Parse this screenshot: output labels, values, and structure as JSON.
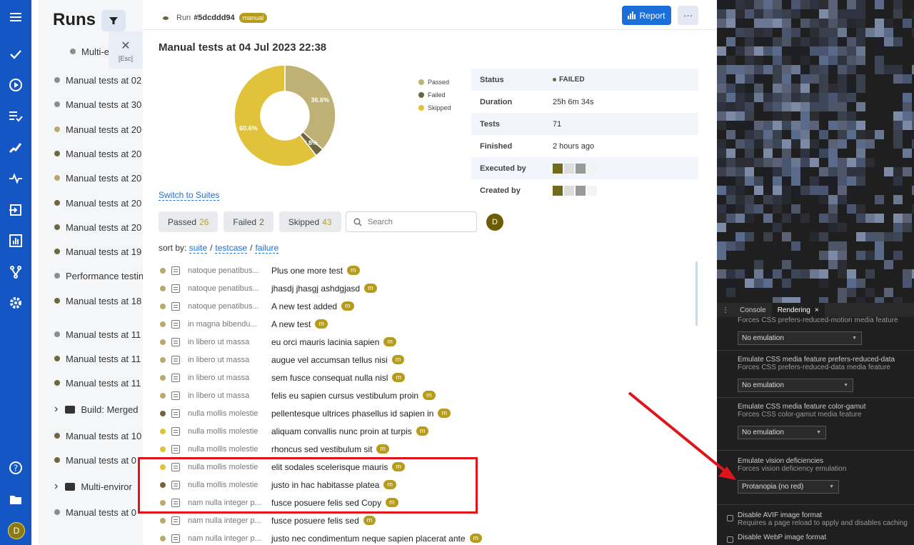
{
  "runs_panel": {
    "title": "Runs",
    "items": [
      {
        "label": "Multi-e",
        "status": "neutral",
        "type": "run"
      },
      {
        "label": "Manual tests at 02",
        "status": "neutral",
        "type": "run"
      },
      {
        "label": "Manual tests at 30",
        "status": "neutral",
        "type": "run"
      },
      {
        "label": "Manual tests at 20",
        "status": "passed",
        "type": "run"
      },
      {
        "label": "Manual tests at 20",
        "status": "failed",
        "type": "run"
      },
      {
        "label": "Manual tests at 20",
        "status": "passed",
        "type": "run"
      },
      {
        "label": "Manual tests at 20",
        "status": "failed",
        "type": "run"
      },
      {
        "label": "Manual tests at 20",
        "status": "failed",
        "type": "run"
      },
      {
        "label": "Manual tests at 19",
        "status": "failed",
        "type": "run"
      },
      {
        "label": "Performance testin",
        "status": "neutral",
        "type": "run"
      },
      {
        "label": "Manual tests at 18",
        "status": "failed",
        "type": "run"
      },
      {
        "label": "Manual tests at 11",
        "status": "neutral",
        "type": "run"
      },
      {
        "label": "Manual tests at 11",
        "status": "failed",
        "type": "run"
      },
      {
        "label": "Manual tests at 11",
        "status": "failed",
        "type": "run"
      },
      {
        "label": "Build: Merged",
        "status": "",
        "type": "folder"
      },
      {
        "label": "Manual tests at 10",
        "status": "failed",
        "type": "run"
      },
      {
        "label": "Manual tests at 0",
        "status": "failed",
        "type": "run"
      },
      {
        "label": "Multi-enviror",
        "status": "",
        "type": "folder"
      },
      {
        "label": "Manual tests at 0",
        "status": "neutral",
        "type": "run"
      }
    ],
    "esc_label": "[Esc]"
  },
  "rail": {
    "avatar_initial": "D",
    "icons": [
      "menu-icon",
      "check-icon",
      "play-icon",
      "list-check-icon",
      "steps-icon",
      "pulse-icon",
      "import-icon",
      "bar-chart-icon",
      "branch-icon",
      "gear-icon",
      "help-icon",
      "folder-icon"
    ]
  },
  "topbar": {
    "run_prefix": "Run",
    "run_id": "#5dcddd94",
    "run_badge": "manual",
    "report_label": "Report",
    "more_label": "···"
  },
  "run": {
    "title": "Manual tests at 04 Jul 2023 22:38",
    "switch_label": "Switch to Suites",
    "details": [
      {
        "key": "Status",
        "value": "FAILED"
      },
      {
        "key": "Duration",
        "value": "25h 6m 34s"
      },
      {
        "key": "Tests",
        "value": "71"
      },
      {
        "key": "Finished",
        "value": "2 hours ago"
      },
      {
        "key": "Executed by",
        "value": ""
      },
      {
        "key": "Created by",
        "value": ""
      }
    ]
  },
  "chart_data": {
    "type": "pie",
    "categories": [
      "Passed",
      "Failed",
      "Skipped"
    ],
    "values": [
      36.6,
      2.8,
      60.6
    ],
    "slice_labels": [
      "36.6%",
      "2.8%",
      "60.6%"
    ],
    "colors": [
      "#bfb074",
      "#6f6640",
      "#e0c33a"
    ],
    "legend": "right"
  },
  "filters": {
    "passed_label": "Passed",
    "passed_count": "26",
    "failed_label": "Failed",
    "failed_count": "2",
    "skipped_label": "Skipped",
    "skipped_count": "43",
    "search_placeholder": "Search",
    "user_initial": "D"
  },
  "sort": {
    "label": "sort by:",
    "options": [
      "suite",
      "testcase",
      "failure"
    ]
  },
  "tests": [
    {
      "status": "passed",
      "suite": "natoque penatibus...",
      "name": "Plus one more test",
      "tag": "m"
    },
    {
      "status": "passed",
      "suite": "natoque penatibus...",
      "name": "jhasdj jhasgj ashdgjasd",
      "tag": "m"
    },
    {
      "status": "passed",
      "suite": "natoque penatibus...",
      "name": "A new test added",
      "tag": "m"
    },
    {
      "status": "passed",
      "suite": "in magna bibendu...",
      "name": "A new test",
      "tag": "m"
    },
    {
      "status": "passed",
      "suite": "in libero ut massa",
      "name": "eu orci mauris lacinia sapien",
      "tag": "m"
    },
    {
      "status": "passed",
      "suite": "in libero ut massa",
      "name": "augue vel accumsan tellus nisi",
      "tag": "m"
    },
    {
      "status": "passed",
      "suite": "in libero ut massa",
      "name": "sem fusce consequat nulla nisl",
      "tag": "m"
    },
    {
      "status": "passed",
      "suite": "in libero ut massa",
      "name": "felis eu sapien cursus vestibulum proin",
      "tag": "m"
    },
    {
      "status": "failed",
      "suite": "nulla mollis molestie",
      "name": "pellentesque ultrices phasellus id sapien in",
      "tag": "m"
    },
    {
      "status": "skipped",
      "suite": "nulla mollis molestie",
      "name": "aliquam convallis nunc proin at turpis",
      "tag": "m"
    },
    {
      "status": "skipped",
      "suite": "nulla mollis molestie",
      "name": "rhoncus sed vestibulum sit",
      "tag": "m"
    },
    {
      "status": "skipped",
      "suite": "nulla mollis molestie",
      "name": "elit sodales scelerisque mauris",
      "tag": "m"
    },
    {
      "status": "failed",
      "suite": "nulla mollis molestie",
      "name": "justo in hac habitasse platea",
      "tag": "m"
    },
    {
      "status": "passed",
      "suite": "nam nulla integer p...",
      "name": "fusce posuere felis sed Copy",
      "tag": "m"
    },
    {
      "status": "passed",
      "suite": "nam nulla integer p...",
      "name": "fusce posuere felis sed",
      "tag": "m"
    },
    {
      "status": "passed",
      "suite": "nam nulla integer p...",
      "name": "justo nec condimentum neque sapien placerat ante",
      "tag": "m"
    }
  ],
  "devtools": {
    "tab_console": "Console",
    "tab_rendering": "Rendering",
    "tab_close": "×",
    "kebab": "⋮",
    "reduced_motion_sub": "Forces CSS prefers-reduced-motion media feature",
    "reduced_motion_value": "No emulation",
    "reduced_data_title": "Emulate CSS media feature prefers-reduced-data",
    "reduced_data_sub": "Forces CSS prefers-reduced-data media feature",
    "reduced_data_value": "No emulation",
    "color_gamut_title": "Emulate CSS media feature color-gamut",
    "color_gamut_sub": "Forces CSS color-gamut media feature",
    "color_gamut_value": "No emulation",
    "vision_title": "Emulate vision deficiencies",
    "vision_sub": "Forces vision deficiency emulation",
    "vision_value": "Protanopia (no red)",
    "avif_title": "Disable AVIF image format",
    "avif_sub": "Requires a page reload to apply and disables caching",
    "webp_title": "Disable WebP image format"
  }
}
